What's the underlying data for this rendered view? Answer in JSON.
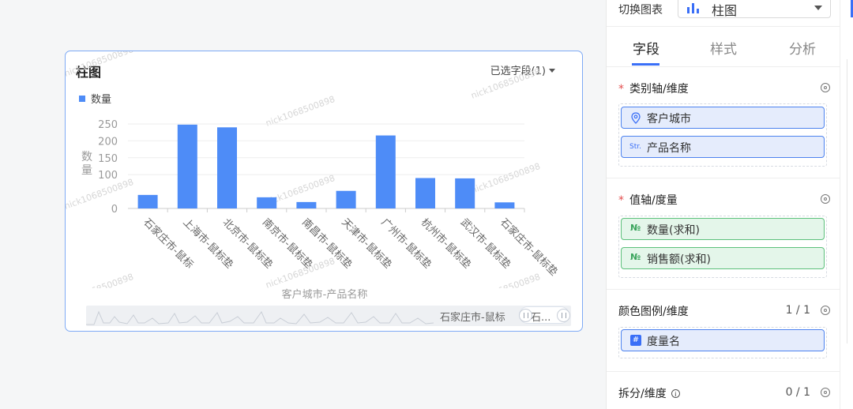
{
  "chart_card": {
    "title": "柱图",
    "field_dropdown": "已选字段(1)",
    "x_axis_title": "客户城市-产品名称",
    "slider": {
      "start_label": "石家庄市-鼠标",
      "end_label": "石..."
    },
    "watermark": "nick1068500898"
  },
  "chart_data": {
    "type": "bar",
    "categories": [
      "石家庄市-鼠标",
      "上海市-鼠标垫",
      "北京市-鼠标垫",
      "南京市-鼠标垫",
      "南昌市-鼠标垫",
      "天津市-鼠标垫",
      "广州市-鼠标垫",
      "杭州市-鼠标垫",
      "武汉市-鼠标垫",
      "石家庄市-鼠标垫"
    ],
    "series": [
      {
        "name": "数量",
        "values": [
          40,
          248,
          240,
          33,
          19,
          52,
          216,
          90,
          89,
          18
        ]
      }
    ],
    "title": "柱图",
    "xlabel": "客户城市-产品名称",
    "ylabel": "数量",
    "yticks": [
      "0",
      "100",
      "150",
      "200",
      "250"
    ],
    "ylim": [
      0,
      250
    ],
    "grid": true,
    "legend_position": "top-left",
    "color": "#4e8cf7"
  },
  "panel": {
    "switch_label": "切换图表",
    "switch_value": "柱图",
    "tabs": [
      "字段",
      "样式",
      "分析"
    ],
    "category_axis": {
      "title": "类别轴/维度",
      "fields": [
        "客户城市",
        "产品名称"
      ],
      "icons": [
        "location-pin-icon",
        "string-type-icon"
      ],
      "icon_text": [
        "",
        "Str."
      ]
    },
    "value_axis": {
      "title": "值轴/度量",
      "fields": [
        "数量(求和)",
        "销售额(求和)"
      ],
      "icon_text": [
        "№",
        "№"
      ]
    },
    "color_legend": {
      "title": "颜色图例/维度",
      "count": "1 / 1",
      "fields": [
        "度量名"
      ],
      "icon_text": [
        "#"
      ]
    },
    "split": {
      "title": "拆分/维度",
      "count": "0 / 1",
      "info": "i"
    }
  },
  "colors": {
    "accent": "#3a6ff7",
    "bar": "#4e8cf7",
    "dimension_pill": "#e5ecfc",
    "measure_pill": "#e4f6ea",
    "required": "#e34d4d"
  }
}
